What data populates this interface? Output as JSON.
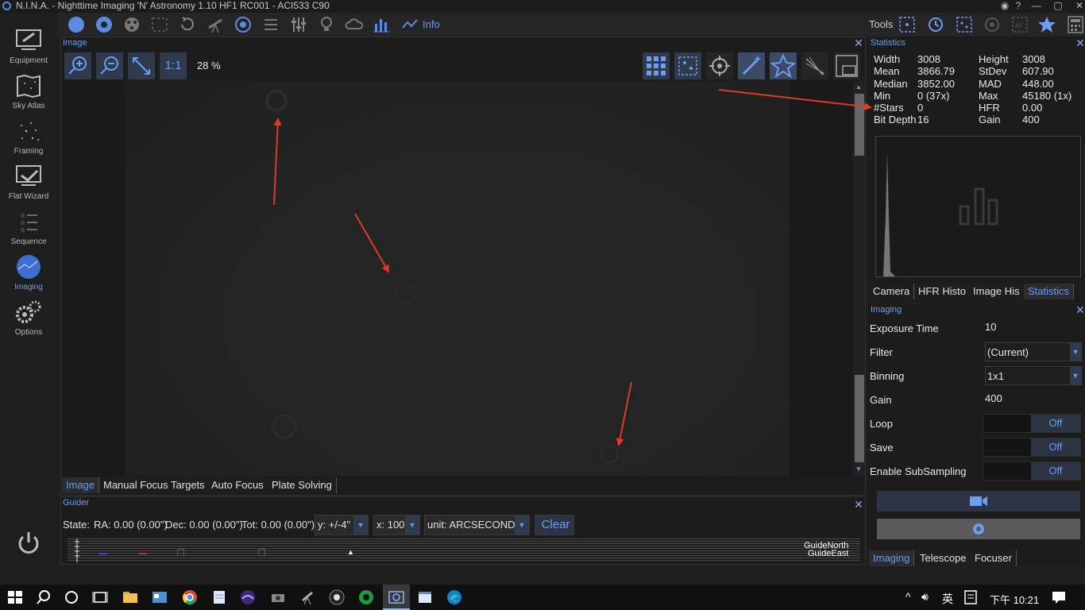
{
  "window": {
    "title": "N.I.N.A. - Nighttime Imaging 'N' Astronomy 1.10 HF1 RC001  -  ACI533 C90",
    "controls": [
      "eye-icon",
      "help-icon",
      "minimize-icon",
      "maximize-icon",
      "close-icon"
    ]
  },
  "sidebar": {
    "items": [
      {
        "label": "Equipment",
        "icon": "telescope-icon"
      },
      {
        "label": "Sky Atlas",
        "icon": "map-icon"
      },
      {
        "label": "Framing",
        "icon": "stars-icon"
      },
      {
        "label": "Flat Wizard",
        "icon": "flat-wizard-icon"
      },
      {
        "label": "Sequence",
        "icon": "sequence-icon"
      },
      {
        "label": "Imaging",
        "icon": "imaging-icon"
      },
      {
        "label": "Options",
        "icon": "gears-icon"
      }
    ],
    "active": "Imaging",
    "power_icon": "power-icon"
  },
  "toolbar": {
    "info_label": "Info",
    "tools_label": "Tools"
  },
  "image_panel": {
    "title": "Image",
    "zoom_percent": "28 %",
    "one_to_one": "1:1",
    "tabs": [
      "Image",
      "Manual Focus Targets",
      "Auto Focus",
      "Plate Solving"
    ],
    "active_tab": "Image"
  },
  "guider": {
    "title": "Guider",
    "state": "State:",
    "ra": "RA: 0.00 (0.00\")",
    "dec": "Dec: 0.00 (0.00\")",
    "tot": "Tot: 0.00 (0.00\")",
    "y_scale": "y: +/-4\"",
    "x_scale": "x: 100",
    "unit": "unit: ARCSECONDS",
    "clear_label": "Clear",
    "guide_north": "GuideNorth",
    "guide_east": "GuideEast"
  },
  "statistics": {
    "title": "Statistics",
    "left": [
      {
        "label": "Width",
        "value": "3008"
      },
      {
        "label": "Mean",
        "value": "3866.79"
      },
      {
        "label": "Median",
        "value": "3852.00"
      },
      {
        "label": "Min",
        "value": "0 (37x)"
      },
      {
        "label": "#Stars",
        "value": "0"
      },
      {
        "label": "Bit Depth",
        "value": "16"
      }
    ],
    "right": [
      {
        "label": "Height",
        "value": "3008"
      },
      {
        "label": "StDev",
        "value": "607.90"
      },
      {
        "label": "MAD",
        "value": "448.00"
      },
      {
        "label": "Max",
        "value": "45180 (1x)"
      },
      {
        "label": "HFR",
        "value": "0.00"
      },
      {
        "label": "Gain",
        "value": "400"
      }
    ],
    "tabs": [
      "Camera",
      "HFR Histo",
      "Image His",
      "Statistics"
    ],
    "active_tab": "Statistics"
  },
  "imaging": {
    "title": "Imaging",
    "fields": [
      {
        "label": "Exposure Time",
        "value": "10"
      },
      {
        "label": "Filter",
        "value": "(Current)"
      },
      {
        "label": "Binning",
        "value": "1x1"
      },
      {
        "label": "Gain",
        "value": "400"
      },
      {
        "label": "Loop",
        "value": "Off"
      },
      {
        "label": "Save",
        "value": "Off"
      },
      {
        "label": "Enable SubSampling",
        "value": "Off"
      }
    ],
    "tabs": [
      "Imaging",
      "Telescope",
      "Focuser"
    ],
    "active_tab": "Imaging"
  },
  "taskbar": {
    "ime": "英",
    "clock": "下午 10:21"
  },
  "colors": {
    "accent": "#6e9cf0",
    "annotation_arrow": "#e03a22",
    "panel_bg": "#1c1c1c"
  }
}
